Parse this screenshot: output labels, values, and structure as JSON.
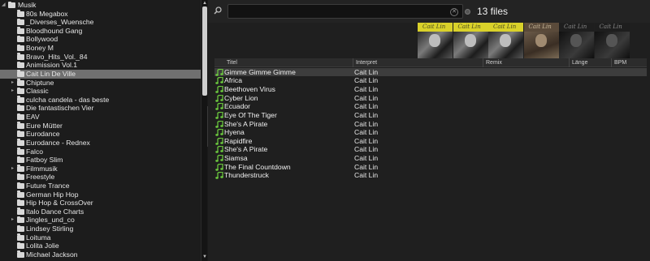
{
  "tree": {
    "root": "Musik",
    "items": [
      {
        "label": "80s Megabox",
        "expandable": false
      },
      {
        "label": "_Diverses_Wuensche",
        "expandable": false
      },
      {
        "label": "Bloodhound Gang",
        "expandable": false
      },
      {
        "label": "Bollywood",
        "expandable": false
      },
      {
        "label": "Boney M",
        "expandable": false
      },
      {
        "label": "Bravo_Hits_Vol._84",
        "expandable": false
      },
      {
        "label": "Animission Vol.1",
        "expandable": false
      },
      {
        "label": "Cait Lin De Ville",
        "expandable": false,
        "selected": true
      },
      {
        "label": "Chiptune",
        "expandable": true
      },
      {
        "label": "Classic",
        "expandable": true
      },
      {
        "label": "culcha candela - das beste",
        "expandable": false
      },
      {
        "label": "Die fantastischen Vier",
        "expandable": false
      },
      {
        "label": "EAV",
        "expandable": false
      },
      {
        "label": "Eure Mütter",
        "expandable": false
      },
      {
        "label": "Eurodance",
        "expandable": false
      },
      {
        "label": "Eurodance - Rednex",
        "expandable": false
      },
      {
        "label": "Falco",
        "expandable": false
      },
      {
        "label": "Fatboy Slim",
        "expandable": false
      },
      {
        "label": "Filmmusik",
        "expandable": true
      },
      {
        "label": "Freestyle",
        "expandable": false
      },
      {
        "label": "Future Trance",
        "expandable": false
      },
      {
        "label": "German Hip Hop",
        "expandable": false
      },
      {
        "label": "Hip Hop & CrossOver",
        "expandable": false
      },
      {
        "label": "Italo Dance Charts",
        "expandable": false
      },
      {
        "label": "Jingles_und_co",
        "expandable": true
      },
      {
        "label": "Lindsey Stirling",
        "expandable": false
      },
      {
        "label": "Loituma",
        "expandable": false
      },
      {
        "label": "Lolita Jolie",
        "expandable": false
      },
      {
        "label": "Michael Jackson",
        "expandable": false
      }
    ]
  },
  "folders_tab": "folders",
  "search": {
    "value": "",
    "placeholder": ""
  },
  "file_count": "13 files",
  "covers": [
    {
      "text": "Cait Lin",
      "style": "yellow"
    },
    {
      "text": "Cait Lin",
      "style": "yellow"
    },
    {
      "text": "Cait Lin",
      "style": "yellow"
    },
    {
      "text": "Cait Lin",
      "style": "sepia"
    },
    {
      "text": "Cait Lin",
      "style": "dark"
    },
    {
      "text": "Cait Lin",
      "style": "dark"
    }
  ],
  "table": {
    "columns": [
      "Titel",
      "Interpret",
      "Remix",
      "Länge",
      "BPM"
    ],
    "rows": [
      {
        "title": "Gimme Gimme Gimme",
        "artist": "Cait Lin",
        "selected": true
      },
      {
        "title": "Africa",
        "artist": "Cait Lin"
      },
      {
        "title": "Beethoven Virus",
        "artist": "Cait Lin"
      },
      {
        "title": "Cyber Lion",
        "artist": "Cait Lin"
      },
      {
        "title": "Ecuador",
        "artist": "Cait Lin"
      },
      {
        "title": "Eye Of The Tiger",
        "artist": "Cait Lin"
      },
      {
        "title": "She's A Pirate",
        "artist": "Cait Lin"
      },
      {
        "title": "Hyena",
        "artist": "Cait Lin"
      },
      {
        "title": "Rapidfire",
        "artist": "Cait Lin"
      },
      {
        "title": "She's A Pirate",
        "artist": "Cait Lin"
      },
      {
        "title": "Siamsa",
        "artist": "Cait Lin"
      },
      {
        "title": "The Final Countdown",
        "artist": "Cait Lin"
      },
      {
        "title": "Thunderstruck",
        "artist": "Cait Lin"
      }
    ]
  },
  "colors": {
    "note_icon": "#6fcf3f",
    "selection": "#707070"
  }
}
